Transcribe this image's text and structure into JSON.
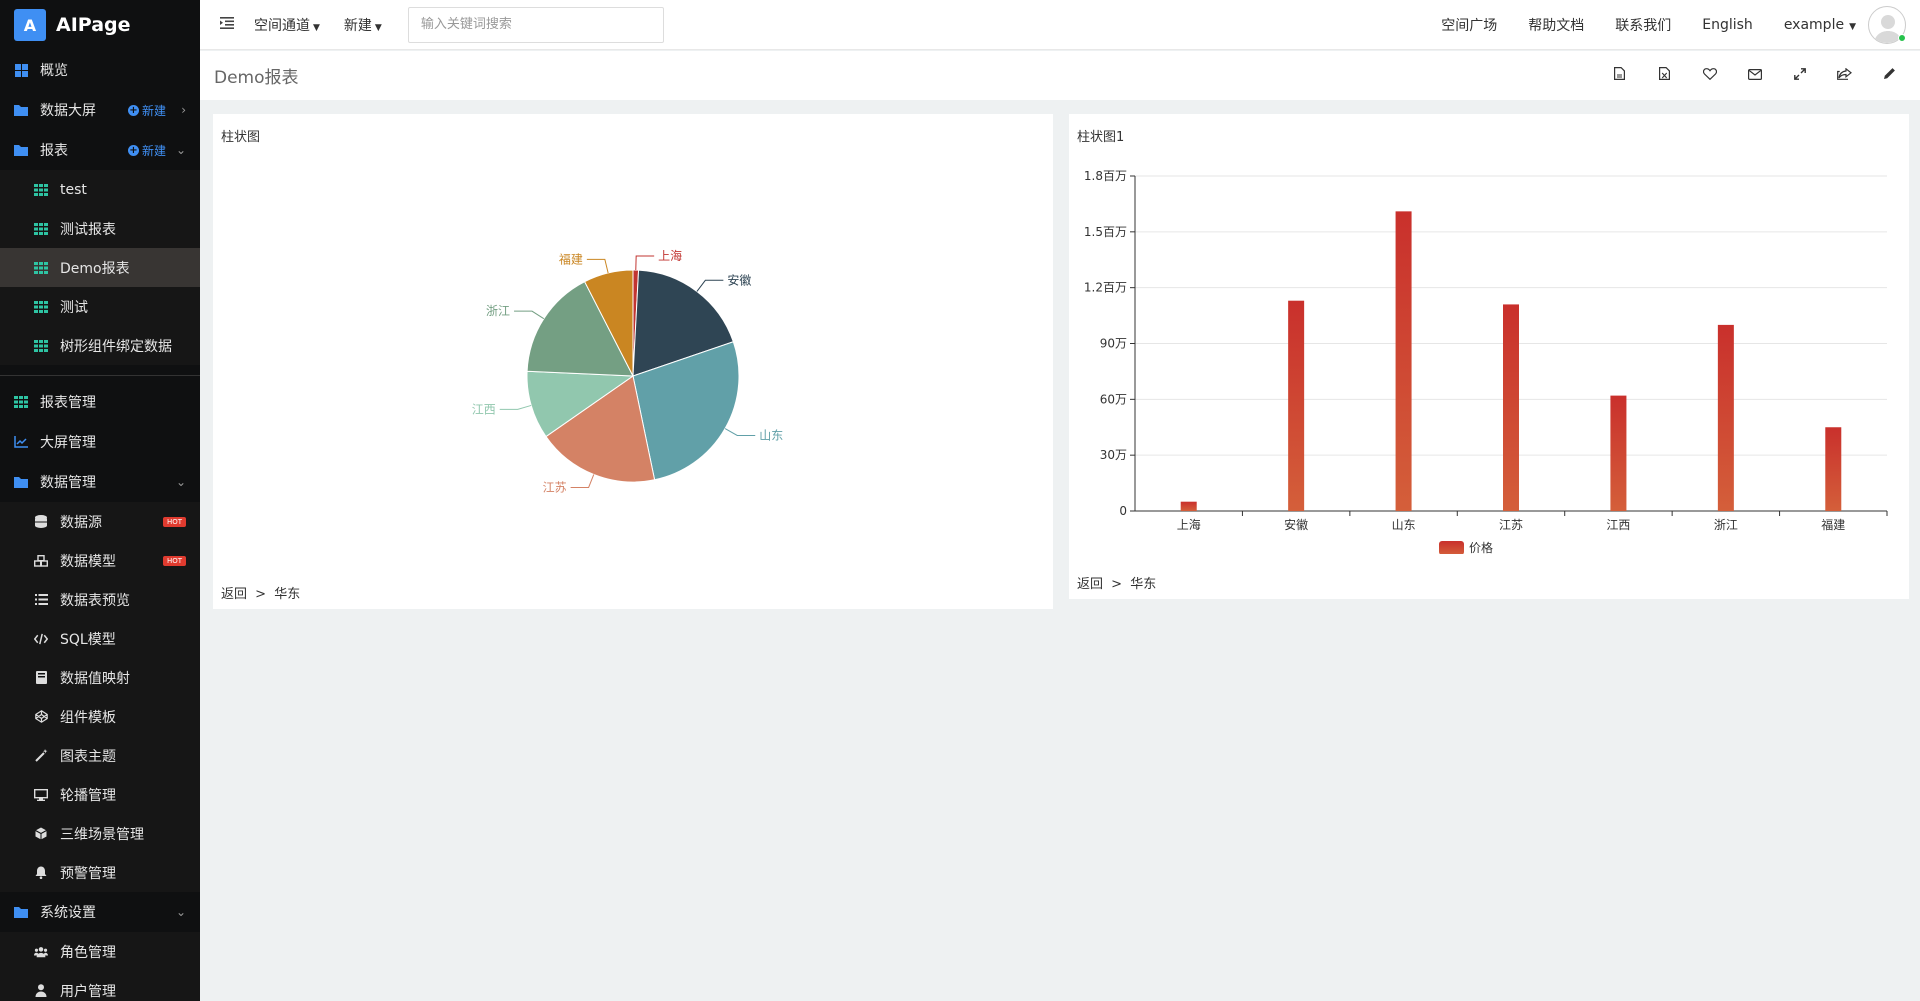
{
  "brand": {
    "logo_letter": "A",
    "name": "AIPage"
  },
  "sidebar": {
    "items": [
      {
        "label": "概览"
      },
      {
        "label": "数据大屏",
        "new": "新建"
      },
      {
        "label": "报表",
        "new": "新建"
      },
      {
        "label": "test"
      },
      {
        "label": "测试报表"
      },
      {
        "label": "Demo报表"
      },
      {
        "label": "测试"
      },
      {
        "label": "树形组件绑定数据"
      },
      {
        "label": "报表管理"
      },
      {
        "label": "大屏管理"
      },
      {
        "label": "数据管理"
      },
      {
        "label": "数据源",
        "badge": "HOT"
      },
      {
        "label": "数据模型",
        "badge": "HOT"
      },
      {
        "label": "数据表预览"
      },
      {
        "label": "SQL模型"
      },
      {
        "label": "数据值映射"
      },
      {
        "label": "组件模板"
      },
      {
        "label": "图表主题"
      },
      {
        "label": "轮播管理"
      },
      {
        "label": "三维场景管理"
      },
      {
        "label": "预警管理"
      },
      {
        "label": "系统设置"
      },
      {
        "label": "角色管理"
      },
      {
        "label": "用户管理"
      }
    ]
  },
  "topbar": {
    "space_menu": "空间通道",
    "new_menu": "新建",
    "search_placeholder": "输入关键词搜索",
    "links": [
      "空间广场",
      "帮助文档",
      "联系我们",
      "English"
    ],
    "user": "example"
  },
  "page": {
    "title": "Demo报表"
  },
  "panel1": {
    "title": "柱状图",
    "footer_back": "返回",
    "footer_sep": ">",
    "footer_region": "华东"
  },
  "panel2": {
    "title": "柱状图1",
    "footer_back": "返回",
    "footer_sep": ">",
    "footer_region": "华东"
  },
  "chart_data": [
    {
      "type": "pie",
      "labels": [
        "上海",
        "安徽",
        "山东",
        "江苏",
        "江西",
        "浙江",
        "福建"
      ],
      "values": [
        50000,
        1130000,
        1610000,
        1110000,
        620000,
        1000000,
        450000
      ],
      "colors": [
        "#c23531",
        "#2f4554",
        "#61a0a8",
        "#d48265",
        "#91c7ae",
        "#749f83",
        "#ca8622"
      ]
    },
    {
      "type": "bar",
      "categories": [
        "上海",
        "安徽",
        "山东",
        "江苏",
        "江西",
        "浙江",
        "福建"
      ],
      "series": [
        {
          "name": "价格",
          "values": [
            50000,
            1130000,
            1610000,
            1110000,
            620000,
            1000000,
            450000
          ]
        }
      ],
      "yticks": [
        "0",
        "30万",
        "60万",
        "90万",
        "1.2百万",
        "1.5百万",
        "1.8百万"
      ],
      "ylim": [
        0,
        1800000
      ],
      "colors": {
        "top": "#c9302c",
        "bottom": "#d45f3a"
      }
    }
  ]
}
